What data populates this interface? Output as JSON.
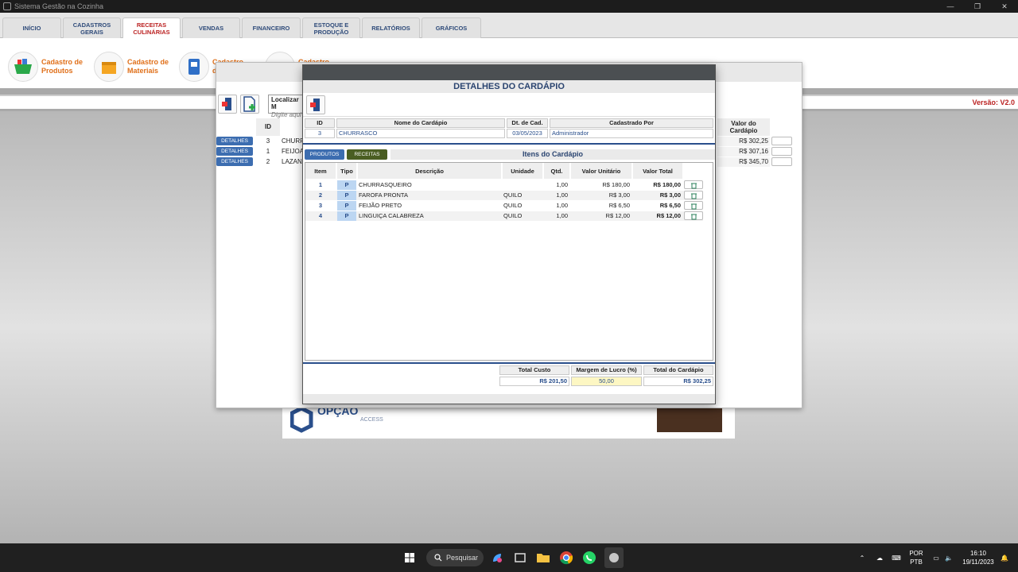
{
  "window": {
    "title": "Sistema Gestão na Cozinha"
  },
  "tabs": [
    {
      "label": "INÍCIO"
    },
    {
      "label": "CADASTROS GERAIS"
    },
    {
      "label": "RECEITAS CULINÁRIAS"
    },
    {
      "label": "VENDAS"
    },
    {
      "label": "FINANCEIRO"
    },
    {
      "label": "ESTOQUE E PRODUÇÃO"
    },
    {
      "label": "RELATÓRIOS"
    },
    {
      "label": "GRÁFICOS"
    }
  ],
  "ribbon": [
    {
      "label": "Cadastro de Produtos"
    },
    {
      "label": "Cadastro de Materiais"
    },
    {
      "label": "Cadastro de R"
    },
    {
      "label": "Cadastro de"
    }
  ],
  "version": "Versão: V2.0",
  "background_list": {
    "search_label": "Localizar M",
    "search_placeholder": "Digite aqui",
    "col_id": "ID",
    "col_value": "Valor do Cardápio",
    "details_label": "DETALHES",
    "rows": [
      {
        "id": "3",
        "name": "CHURR",
        "value": "R$ 302,25"
      },
      {
        "id": "1",
        "name": "FEIJOA",
        "value": "R$ 307,16"
      },
      {
        "id": "2",
        "name": "LAZAN",
        "value": "R$ 345,70"
      }
    ]
  },
  "logo": {
    "name": "OPÇÃO",
    "sub": "ACCESS"
  },
  "modal": {
    "title": "DETALHES DO CARDÁPIO",
    "header": {
      "id_label": "ID",
      "name_label": "Nome do Cardápio",
      "date_label": "Dt. de Cad.",
      "by_label": "Cadastrado Por",
      "id": "3",
      "name": "CHURRASCO",
      "date": "03/05/2023",
      "by": "Administrador"
    },
    "subtabs": {
      "products": "PRODUTOS",
      "recipes": "RECEITAS"
    },
    "items_title": "Itens do Cardápio",
    "columns": {
      "item": "Item",
      "tipo": "Tipo",
      "desc": "Descrição",
      "unit": "Unidade",
      "qty": "Qtd.",
      "unit_value": "Valor Unitário",
      "total": "Valor Total"
    },
    "items": [
      {
        "item": "1",
        "tipo": "P",
        "desc": "CHURRASQUEIRO",
        "unit": "",
        "qty": "1,00",
        "unit_value": "R$ 180,00",
        "total": "R$ 180,00"
      },
      {
        "item": "2",
        "tipo": "P",
        "desc": "FAROFA PRONTA",
        "unit": "QUILO",
        "qty": "1,00",
        "unit_value": "R$ 3,00",
        "total": "R$ 3,00"
      },
      {
        "item": "3",
        "tipo": "P",
        "desc": "FEIJÃO PRETO",
        "unit": "QUILO",
        "qty": "1,00",
        "unit_value": "R$ 6,50",
        "total": "R$ 6,50"
      },
      {
        "item": "4",
        "tipo": "P",
        "desc": "LINGUIÇA CALABREZA",
        "unit": "QUILO",
        "qty": "1,00",
        "unit_value": "R$ 12,00",
        "total": "R$ 12,00"
      }
    ],
    "totals": {
      "cost_label": "Total Custo",
      "margin_label": "Margem de  Lucro (%)",
      "total_label": "Total do Cardápio",
      "cost": "R$ 201,50",
      "margin": "50,00",
      "total": "R$ 302,25"
    }
  },
  "taskbar": {
    "search": "Pesquisar",
    "lang": "POR",
    "layout": "PTB",
    "time": "16:10",
    "date": "19/11/2023"
  },
  "colors": {
    "tab_active": "#b22222",
    "accent_blue": "#2a4f8c",
    "ribbon_orange": "#e0701a",
    "margin_bg": "#fdf7c3"
  }
}
